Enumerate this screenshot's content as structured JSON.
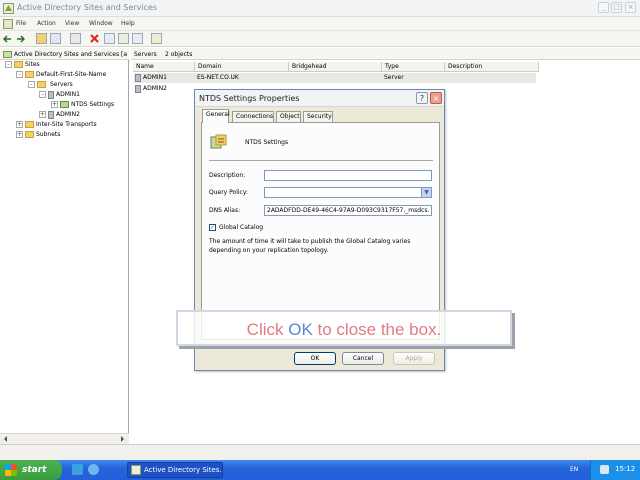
{
  "window": {
    "title": "Active Directory Sites and Services",
    "controls": [
      "_",
      "□",
      "×"
    ]
  },
  "menubar": {
    "items": [
      "File",
      "Action",
      "View",
      "Window",
      "Help"
    ]
  },
  "tree": {
    "header": "Active Directory Sites and Services [a",
    "nodes": [
      {
        "label": "Active Directory Sites and Services [a",
        "icon": "sites-icon"
      },
      {
        "label": "Sites",
        "icon": "folder-icon",
        "expander": "-"
      },
      {
        "label": "Default-First-Site-Name",
        "icon": "folder-icon",
        "expander": "-"
      },
      {
        "label": "Servers",
        "icon": "folder-icon",
        "expander": "-"
      },
      {
        "label": "ADMIN1",
        "icon": "server-icon",
        "expander": "-"
      },
      {
        "label": "NTDS Settings",
        "icon": "ntds-icon",
        "expander": "+"
      },
      {
        "label": "ADMIN2",
        "icon": "server-icon",
        "expander": "+"
      },
      {
        "label": "Inter-Site Transports",
        "icon": "folder-icon",
        "expander": "+"
      },
      {
        "label": "Subnets",
        "icon": "folder-icon",
        "expander": "+"
      }
    ]
  },
  "list": {
    "location": "Servers",
    "count": "2 objects",
    "columns": [
      "Name",
      "Domain",
      "Bridgehead",
      "Type",
      "Description"
    ],
    "rows": [
      {
        "name": "ADMIN1",
        "domain": "ES-NET.CO.UK",
        "bridgehead": "",
        "type": "Server",
        "description": ""
      },
      {
        "name": "ADMIN2",
        "domain": "",
        "bridgehead": "",
        "type": "",
        "description": ""
      }
    ]
  },
  "dialog": {
    "title": "NTDS Settings Properties",
    "help_btn": "?",
    "close_btn": "×",
    "tabs": [
      "General",
      "Connections",
      "Object",
      "Security"
    ],
    "object_name": "NTDS Settings",
    "description_label": "Description:",
    "description_value": "",
    "query_policy_label": "Query Policy:",
    "query_policy_value": "",
    "dns_alias_label": "DNS Alias:",
    "dns_alias_value": "2ADADFDD-DE49-46C4-97A9-D093C9317F57._msdcs.",
    "global_catalog_label": "Global Catalog",
    "global_catalog_checked": true,
    "info_text": "The amount of time it will take to publish the Global Catalog varies depending on your replication topology.",
    "ok_label": "OK",
    "cancel_label": "Cancel",
    "apply_label": "Apply"
  },
  "callout": {
    "prefix": "Click ",
    "keyword": "OK",
    "suffix": " to close the box.",
    "text_color": "#e07b82",
    "keyword_color": "#5b86d8"
  },
  "taskbar": {
    "start_label": "start",
    "task_label": "Active Directory Sites...",
    "lang": "EN",
    "clock": "15:12"
  }
}
